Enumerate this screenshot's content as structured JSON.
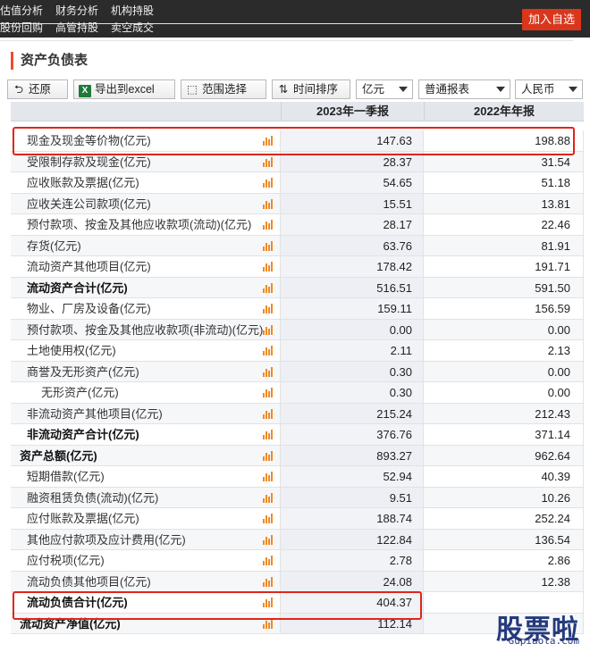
{
  "nav": {
    "row1": [
      "估值分析",
      "财务分析",
      "机构持股"
    ],
    "row2": [
      "股份回购",
      "高管持股",
      "卖空成交"
    ],
    "follow_button": "加入自选"
  },
  "section_title": "资产负债表",
  "toolbar": {
    "restore": "还原",
    "export": "导出到excel",
    "range": "范围选择",
    "time_sort": "时间排序",
    "unit": "亿元",
    "report_type": "普通报表",
    "currency": "人民币"
  },
  "table": {
    "columns": [
      "2023年一季报",
      "2022年年报"
    ],
    "rows": [
      {
        "name": "现金及现金等价物(亿元)",
        "v1": "147.63",
        "v2": "198.88",
        "level": 1
      },
      {
        "name": "受限制存款及现金(亿元)",
        "v1": "28.37",
        "v2": "31.54",
        "level": 1
      },
      {
        "name": "应收账款及票据(亿元)",
        "v1": "54.65",
        "v2": "51.18",
        "level": 1
      },
      {
        "name": "应收关连公司款项(亿元)",
        "v1": "15.51",
        "v2": "13.81",
        "level": 1
      },
      {
        "name": "预付款项、按金及其他应收款项(流动)(亿元)",
        "v1": "28.17",
        "v2": "22.46",
        "level": 1
      },
      {
        "name": "存货(亿元)",
        "v1": "63.76",
        "v2": "81.91",
        "level": 1
      },
      {
        "name": "流动资产其他项目(亿元)",
        "v1": "178.42",
        "v2": "191.71",
        "level": 1
      },
      {
        "name": "流动资产合计(亿元)",
        "v1": "516.51",
        "v2": "591.50",
        "level": 1,
        "bold": true
      },
      {
        "name": "物业、厂房及设备(亿元)",
        "v1": "159.11",
        "v2": "156.59",
        "level": 1
      },
      {
        "name": "预付款项、按金及其他应收款项(非流动)(亿元)",
        "v1": "0.00",
        "v2": "0.00",
        "level": 1
      },
      {
        "name": "土地使用权(亿元)",
        "v1": "2.11",
        "v2": "2.13",
        "level": 1
      },
      {
        "name": "商誉及无形资产(亿元)",
        "v1": "0.30",
        "v2": "0.00",
        "level": 1
      },
      {
        "name": "无形资产(亿元)",
        "v1": "0.30",
        "v2": "0.00",
        "level": 2
      },
      {
        "name": "非流动资产其他项目(亿元)",
        "v1": "215.24",
        "v2": "212.43",
        "level": 1
      },
      {
        "name": "非流动资产合计(亿元)",
        "v1": "376.76",
        "v2": "371.14",
        "level": 1,
        "bold": true
      },
      {
        "name": "资产总额(亿元)",
        "v1": "893.27",
        "v2": "962.64",
        "level": 0,
        "bold": true
      },
      {
        "name": "短期借款(亿元)",
        "v1": "52.94",
        "v2": "40.39",
        "level": 1
      },
      {
        "name": "融资租赁负债(流动)(亿元)",
        "v1": "9.51",
        "v2": "10.26",
        "level": 1
      },
      {
        "name": "应付账款及票据(亿元)",
        "v1": "188.74",
        "v2": "252.24",
        "level": 1
      },
      {
        "name": "其他应付款项及应计费用(亿元)",
        "v1": "122.84",
        "v2": "136.54",
        "level": 1
      },
      {
        "name": "应付税项(亿元)",
        "v1": "2.78",
        "v2": "2.86",
        "level": 1
      },
      {
        "name": "流动负债其他项目(亿元)",
        "v1": "24.08",
        "v2": "12.38",
        "level": 1
      },
      {
        "name": "流动负债合计(亿元)",
        "v1": "404.37",
        "v2": "",
        "level": 1,
        "bold": true
      },
      {
        "name": "流动资产净值(亿元)",
        "v1": "112.14",
        "v2": "",
        "level": 0,
        "bold": true
      }
    ]
  },
  "watermark": {
    "big": "股票啦",
    "small": "Gupiaola.com"
  },
  "colors": {
    "accent": "#e8502b",
    "highlight": "#e0251b",
    "nav_bg": "#2b2b2b",
    "chart_icon": "#f08a24"
  }
}
